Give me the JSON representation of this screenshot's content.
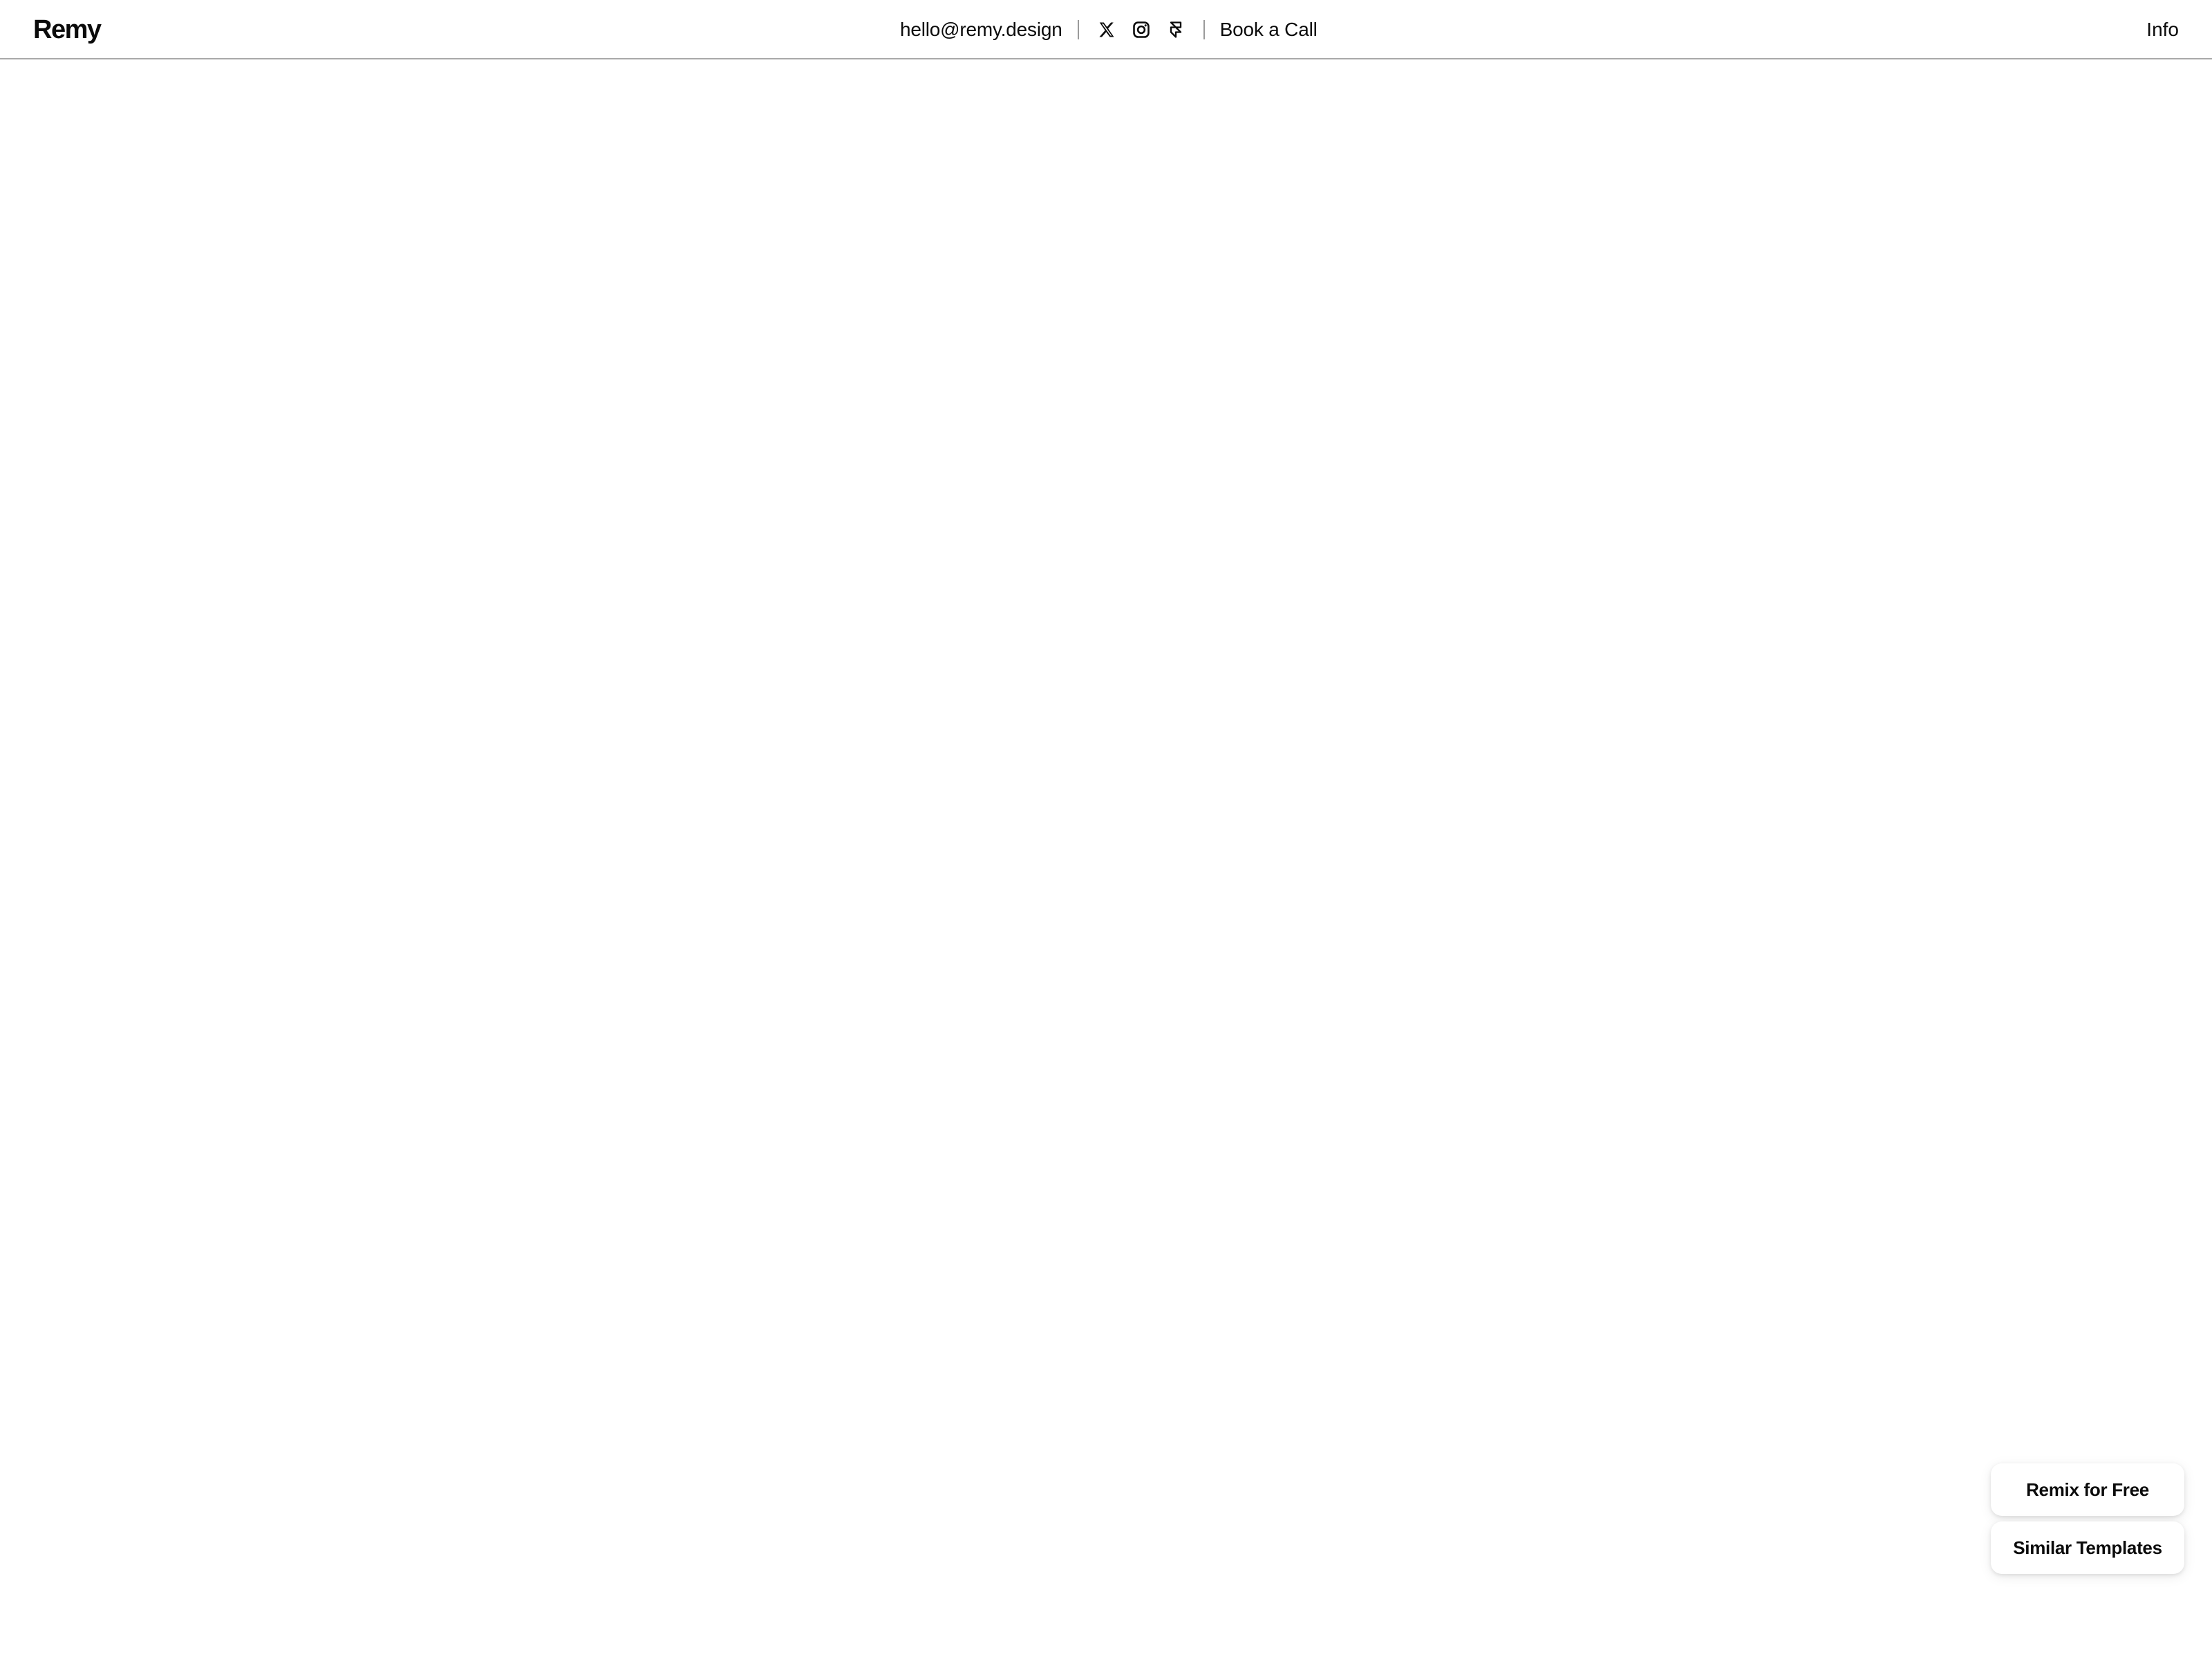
{
  "header": {
    "logo": "Remy",
    "email": "hello@remy.design",
    "social_icons": [
      "x-icon",
      "instagram-icon",
      "framer-icon"
    ],
    "book_call": "Book a Call",
    "info": "Info"
  },
  "floating_actions": {
    "remix": "Remix for Free",
    "similar": "Similar Templates"
  },
  "colors": {
    "background": "#ffffff",
    "text": "#0b0b0b",
    "divider": "#a9a9a9"
  }
}
